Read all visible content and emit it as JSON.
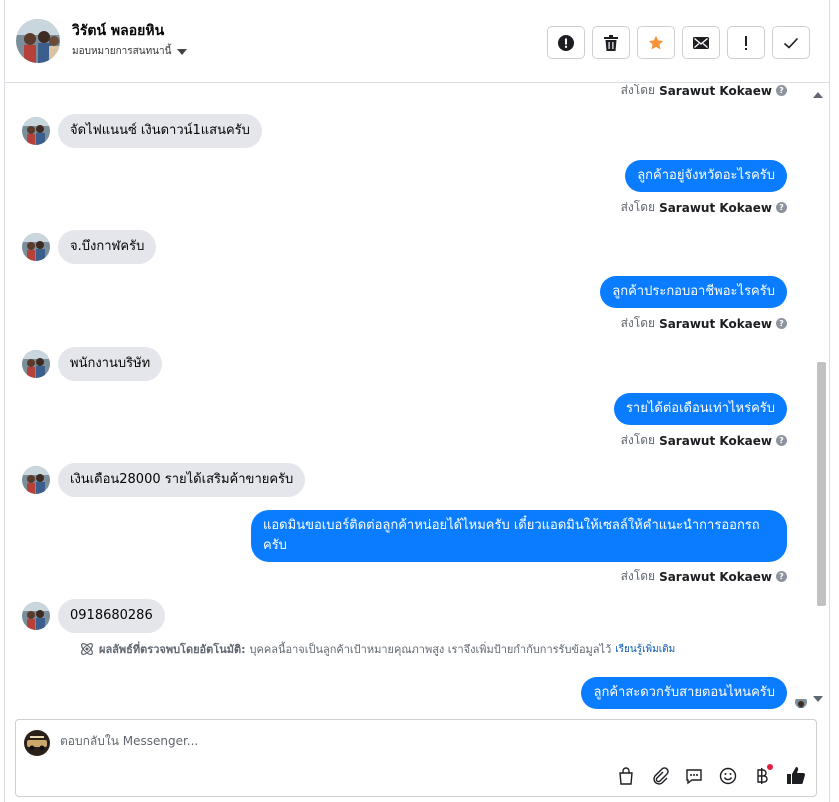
{
  "header": {
    "contact_name": "วิรัตน์ พลอยหิน",
    "assign_label": "มอบหมายการสนทนานี้",
    "actions": [
      {
        "icon": "alert-circle-icon"
      },
      {
        "icon": "trash-icon"
      },
      {
        "icon": "star-icon"
      },
      {
        "icon": "envelope-icon"
      },
      {
        "icon": "exclamation-icon"
      },
      {
        "icon": "checkmark-icon"
      }
    ]
  },
  "thread": {
    "sent_by_prefix": "ส่งโดย",
    "agent_name": "Sarawut Kokaew",
    "messages": [
      {
        "dir": "in",
        "text": "จัดไฟแนนซ์ เงินดาวน์1แสนครับ"
      },
      {
        "dir": "out",
        "text": "ลูกค้าอยู่จังหวัดอะไรครับ"
      },
      {
        "dir": "in",
        "text": "จ.บึงกาฬครับ"
      },
      {
        "dir": "out",
        "text": "ลูกค้าประกอบอาชีพอะไรครับ"
      },
      {
        "dir": "in",
        "text": "พนักงานบริษัท"
      },
      {
        "dir": "out",
        "text": "รายได้ต่อเดือนเท่าไหร่ครับ"
      },
      {
        "dir": "in",
        "text": "เงินเดือน28000 รายได้เสริมค้าขายครับ"
      },
      {
        "dir": "out",
        "text": "แอดมินขอเบอร์ติดต่อลูกค้าหน่อยได้ไหมครับ เดี๋ยวแอดมินให้เซลล์ให้คำแนะนำการออกรถครับ"
      },
      {
        "dir": "in",
        "text": "0918680286"
      },
      {
        "dir": "out",
        "text": "ลูกค้าสะดวกรับสายตอนไหนครับ"
      }
    ],
    "ai_note": {
      "title": "ผลลัพธ์ที่ตรวจพบโดยอัตโนมัติ:",
      "body": "บุคคลนี้อาจเป็นลูกค้าเป้าหมายคุณภาพสูง เราจึงเพิ่มป้ายกำกับการรับข้อมูลไว้",
      "link": "เรียนรู้เพิ่มเติม"
    }
  },
  "composer": {
    "placeholder": "ตอบกลับใน Messenger...",
    "tools": [
      "shopping-bag-icon",
      "paperclip-icon",
      "chat-bubble-icon",
      "emoji-icon",
      "baht-icon",
      "thumbs-up-icon"
    ]
  },
  "colors": {
    "accent": "#0a7cff",
    "incoming_bubble": "#e4e6eb",
    "star": "#f7923b"
  }
}
